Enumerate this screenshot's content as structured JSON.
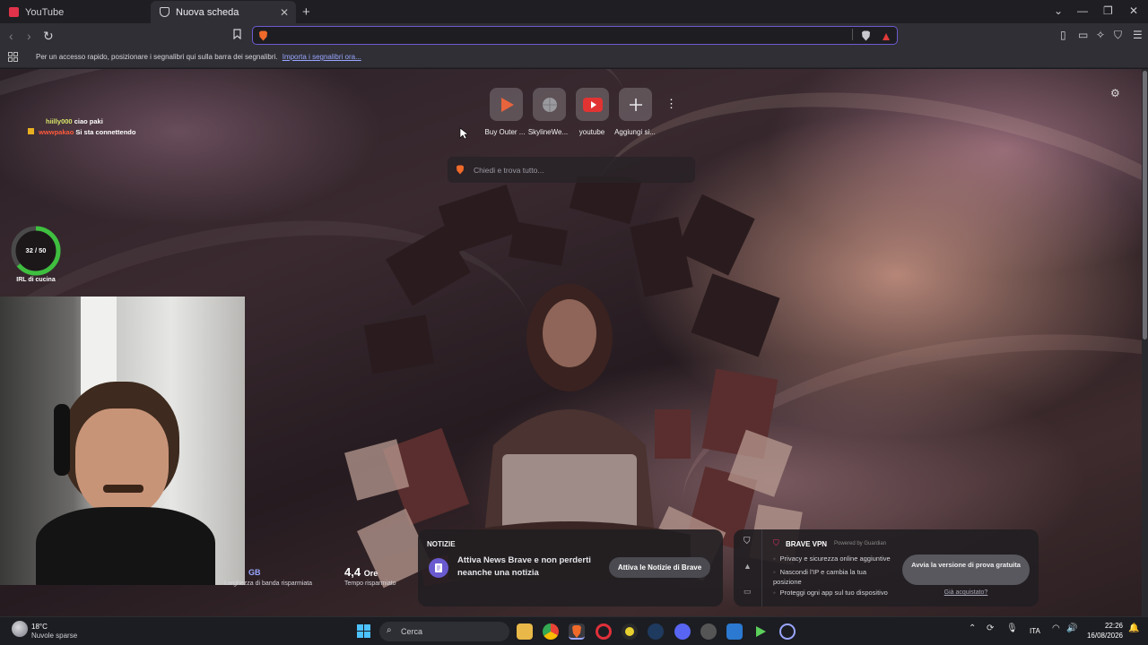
{
  "tabs": [
    {
      "title": "YouTube",
      "active": false
    },
    {
      "title": "Nuova scheda",
      "active": true
    }
  ],
  "bookmarks_bar": {
    "message": "Per un accesso rapido, posizionare i segnalibri qui sulla barra dei segnalibri.",
    "import_link": "Importa i segnalibri ora..."
  },
  "top_sites": [
    {
      "label": "Buy Outer ...",
      "icon": "play-arrow-icon",
      "color": "#e8643c"
    },
    {
      "label": "SkylineWe...",
      "icon": "globe-icon",
      "color": "#8a8a8e"
    },
    {
      "label": "youtube",
      "icon": "youtube-icon",
      "color": "#e23333"
    },
    {
      "label": "Aggiungi si...",
      "icon": "plus-icon",
      "color": "#8a8a8e"
    }
  ],
  "search": {
    "placeholder": "Chiedi e trova tutto..."
  },
  "chat": [
    {
      "user": "hiilly000",
      "message": "ciao paki",
      "user_color": "#d8e86a"
    },
    {
      "user": "wwwpakao",
      "message": "Si sta connettendo",
      "user_color": "#ff5a3c"
    }
  ],
  "goal": {
    "text": "32 / 50",
    "label": "IRL di cucina",
    "progress": 0.64,
    "color": "#3fbf3f"
  },
  "stats": {
    "bandwidth_unit": "GB",
    "bandwidth_label": "Larghezza di banda risparmiata",
    "time_value": "4,4",
    "time_unit": "Ore",
    "time_label": "Tempo risparmiato"
  },
  "news": {
    "header": "NOTIZIE",
    "text": "Attiva News Brave e non perderti neanche una notizia",
    "button": "Attiva le Notizie di Brave"
  },
  "vpn": {
    "title": "BRAVE VPN",
    "powered": "Powered by",
    "provider": "Guardian",
    "features": [
      "Privacy e sicurezza online aggiuntive",
      "Nascondi l'IP e cambia la tua posizione",
      "Proteggi ogni app sul tuo dispositivo"
    ],
    "trial_button": "Avvia la versione di prova gratuita",
    "purchased_link": "Già acquistato?"
  },
  "taskbar": {
    "weather_temp": "18°C",
    "weather_desc": "Nuvole sparse",
    "search_label": "Cerca",
    "language": "ITA",
    "time": "22:26",
    "date": "16/08/2026"
  }
}
